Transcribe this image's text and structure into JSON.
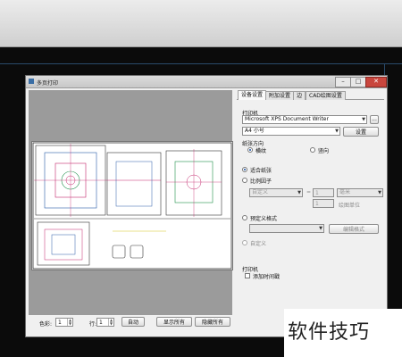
{
  "dialog": {
    "title": "多页打印"
  },
  "tabs": [
    {
      "label": "设备设置"
    },
    {
      "label": "附加设置"
    },
    {
      "label": "边"
    },
    {
      "label": "CAD绘图设置"
    }
  ],
  "printer_section": {
    "title": "打印机",
    "printer_value": "Microsoft XPS Document Writer",
    "more_button": "...",
    "paper_value": "A4 小号",
    "settings_button": "设置"
  },
  "orientation": {
    "title": "纸张方向",
    "options": [
      {
        "label": "横纹",
        "selected": true
      },
      {
        "label": "竖向",
        "selected": false
      }
    ]
  },
  "scale": {
    "fit_label": "适合纸张",
    "ratio_label": "比例因子",
    "custom_select": "自定义",
    "value1": "1",
    "unit": "毫米",
    "value2": "1",
    "drawing_unit": "绘图单位",
    "preset_label": "预定义格式",
    "edit_format_button": "编辑格式",
    "custom_label": "自定义"
  },
  "print_section": {
    "title": "打印机",
    "add_time_label": "添加时间戳"
  },
  "bottom": {
    "color_label": "色彩:",
    "color_value": "1",
    "row_label": "行:",
    "row_value": "1",
    "auto_button": "自动",
    "show_all_button": "显示所有",
    "hide_all_button": "隐藏所有"
  },
  "window_buttons": {
    "minimize": "–",
    "maximize": "□",
    "close": "✕"
  },
  "watermark": {
    "text": "软件技巧"
  }
}
